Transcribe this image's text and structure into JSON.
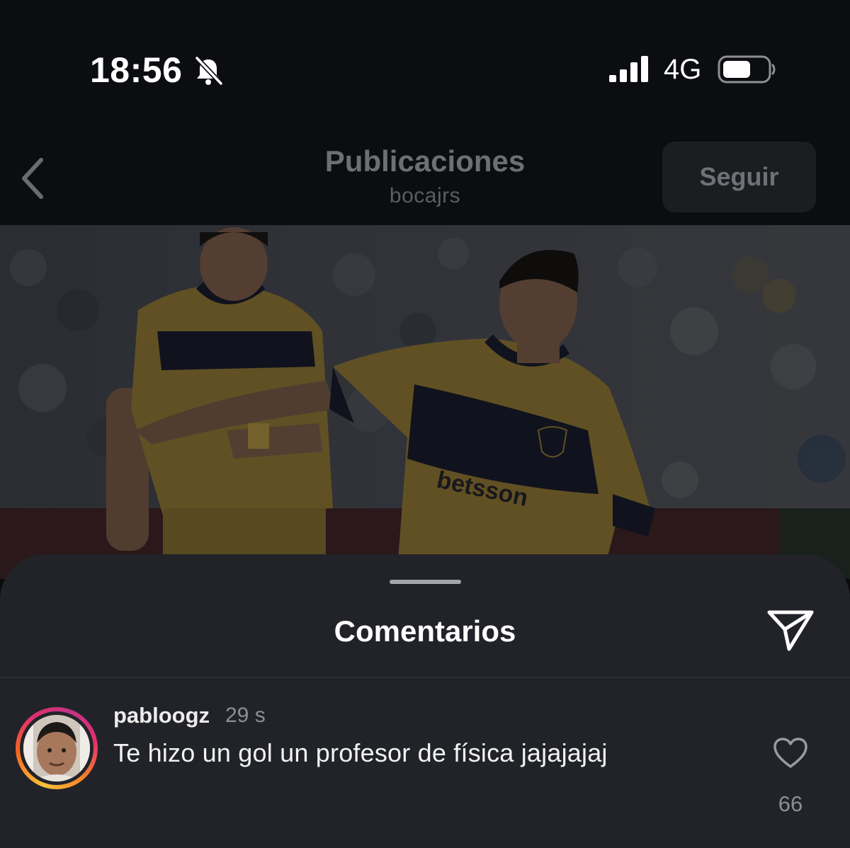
{
  "status_bar": {
    "time": "18:56",
    "network": "4G",
    "silent_mode_icon": "bell-slash-icon",
    "signal_icon": "cellular-signal-icon",
    "battery_icon": "battery-icon"
  },
  "header": {
    "title": "Publicaciones",
    "subtitle": "bocajrs",
    "follow_label": "Seguir",
    "back_icon": "chevron-left-icon"
  },
  "post": {
    "image": "football-players-photo"
  },
  "comments": {
    "title": "Comentarios",
    "share_icon": "paper-plane-icon",
    "items": [
      {
        "username": "pabloogz",
        "time": "29 s",
        "text": "Te hizo un gol un profesor de física jajajajaj",
        "likes": "66",
        "like_icon": "heart-outline-icon"
      }
    ]
  },
  "colors": {
    "background": "#0c0d10",
    "sheet": "#212328",
    "dim_text": "#6e6f73",
    "jersey_gold": "#a88a3e",
    "jersey_navy": "#1c2233"
  }
}
